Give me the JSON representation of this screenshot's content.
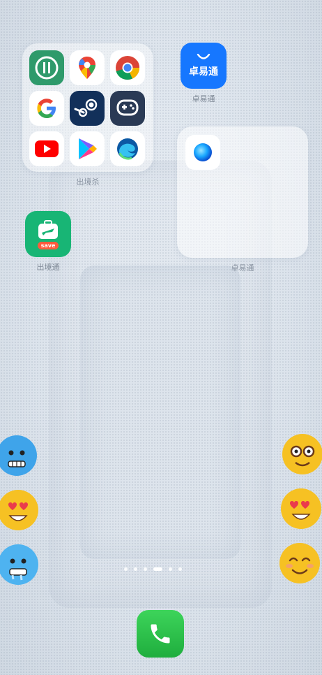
{
  "folder_left": {
    "label": "出境杀",
    "apps": [
      "authenticator-icon",
      "google-maps-icon",
      "chrome-icon",
      "google-icon",
      "steam-icon",
      "gamepad-icon",
      "youtube-icon",
      "play-store-icon",
      "edge-icon"
    ]
  },
  "store_app": {
    "label": "卓易通",
    "badge_text": "卓易通"
  },
  "folder_right": {
    "label": "卓易通"
  },
  "travel_app": {
    "label": "出境通",
    "badge_text": "save"
  },
  "page_indicator": {
    "count": 6,
    "active_index": 3
  },
  "dock": {
    "phone": "phone-icon"
  },
  "colors": {
    "store_blue": "#1677ff",
    "travel_green": "#18b575",
    "phone_green": "#2bc04a"
  }
}
